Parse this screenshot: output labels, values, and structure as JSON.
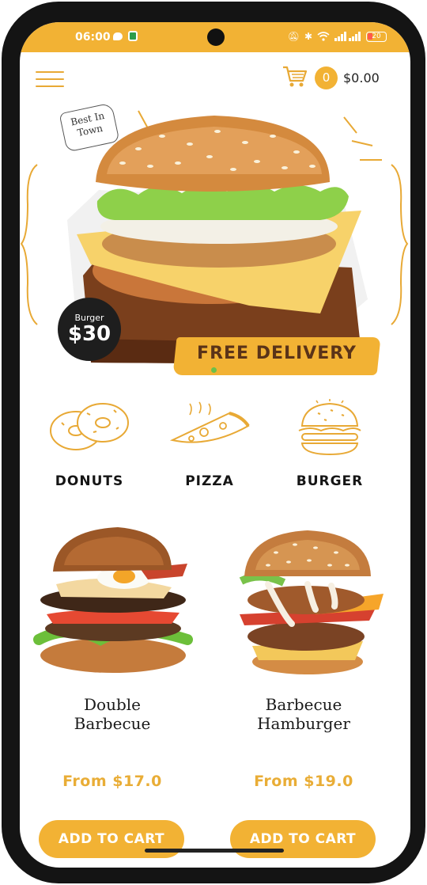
{
  "status_bar": {
    "time": "06:00",
    "battery": "20",
    "icons": [
      "chat-icon",
      "shield-icon",
      "mute-icon",
      "bluetooth-icon",
      "wifi-icon",
      "signal-icon",
      "battery-icon"
    ]
  },
  "header": {
    "menu_icon": "hamburger-menu-icon",
    "cart_icon": "shopping-cart-icon",
    "cart_count": "0",
    "cart_total": "$0.00"
  },
  "banner": {
    "badge_text_line1": "Best In",
    "badge_text_line2": "Town",
    "price_label": "Burger",
    "price_value": "$30",
    "delivery_text": "FREE DELIVERY",
    "accent_color": "#f2b234"
  },
  "categories": [
    {
      "label": "DONUTS",
      "icon": "donut-icon"
    },
    {
      "label": "PIZZA",
      "icon": "pizza-icon"
    },
    {
      "label": "BURGER",
      "icon": "burger-icon"
    }
  ],
  "products": [
    {
      "name_line1": "Double",
      "name_line2": "Barbecue",
      "price": "From $17.0",
      "button": "ADD TO CART"
    },
    {
      "name_line1": "Barbecue",
      "name_line2": "Hamburger",
      "price": "From $19.0",
      "button": "ADD TO CART"
    }
  ]
}
